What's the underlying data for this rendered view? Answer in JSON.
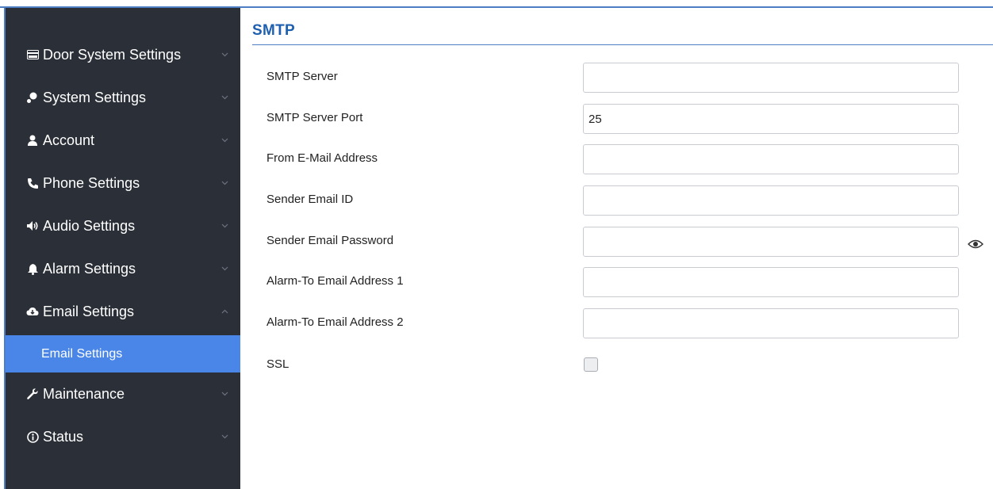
{
  "sidebar": {
    "items": [
      {
        "label": "Door System Settings",
        "icon": "card-icon"
      },
      {
        "label": "System Settings",
        "icon": "keys-icon"
      },
      {
        "label": "Account",
        "icon": "user-icon"
      },
      {
        "label": "Phone Settings",
        "icon": "phone-icon"
      },
      {
        "label": "Audio Settings",
        "icon": "speaker-icon"
      },
      {
        "label": "Alarm Settings",
        "icon": "bell-icon"
      },
      {
        "label": "Email Settings",
        "icon": "cloud-icon",
        "expanded": true
      },
      {
        "label": "Maintenance",
        "icon": "wrench-icon"
      },
      {
        "label": "Status",
        "icon": "info-icon"
      }
    ],
    "sub_item": {
      "label": "Email Settings",
      "active": true
    }
  },
  "section": {
    "title": "SMTP"
  },
  "form": {
    "smtp_server": {
      "label": "SMTP Server",
      "value": ""
    },
    "smtp_port": {
      "label": "SMTP Server Port",
      "value": "25"
    },
    "from_email": {
      "label": "From E-Mail Address",
      "value": ""
    },
    "sender_id": {
      "label": "Sender Email ID",
      "value": ""
    },
    "sender_password": {
      "label": "Sender Email Password",
      "value": ""
    },
    "alarm_to_1": {
      "label": "Alarm-To Email Address 1",
      "value": ""
    },
    "alarm_to_2": {
      "label": "Alarm-To Email Address 2",
      "value": ""
    },
    "ssl": {
      "label": "SSL",
      "checked": false
    }
  },
  "colors": {
    "sidebar_bg": "#2b2f38",
    "active_bg": "#4a86e8",
    "title": "#1f5fb0",
    "accent_line": "#4d7ec4"
  }
}
